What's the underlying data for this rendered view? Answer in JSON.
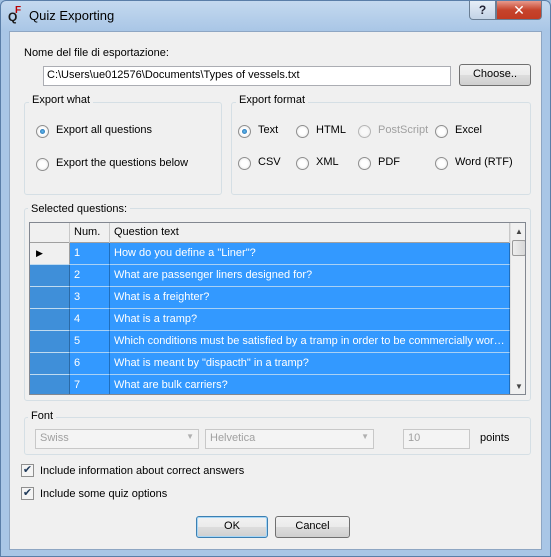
{
  "window": {
    "title": "Quiz Exporting",
    "help_label": "?",
    "close_label": "✕",
    "icon_letters": {
      "q": "Q",
      "f": "F"
    }
  },
  "file": {
    "label": "Nome del file di esportazione:",
    "path": "C:\\Users\\ue012576\\Documents\\Types of vessels.txt",
    "choose_label": "Choose.."
  },
  "export_what": {
    "title": "Export what",
    "options": [
      {
        "label": "Export all questions",
        "checked": true
      },
      {
        "label": "Export the questions below",
        "checked": false
      }
    ]
  },
  "export_format": {
    "title": "Export format",
    "options": [
      {
        "label": "Text",
        "checked": true,
        "enabled": true
      },
      {
        "label": "HTML",
        "checked": false,
        "enabled": true
      },
      {
        "label": "PostScript",
        "checked": false,
        "enabled": false
      },
      {
        "label": "Excel",
        "checked": false,
        "enabled": true
      },
      {
        "label": "CSV",
        "checked": false,
        "enabled": true
      },
      {
        "label": "XML",
        "checked": false,
        "enabled": true
      },
      {
        "label": "PDF",
        "checked": false,
        "enabled": true
      },
      {
        "label": "Word (RTF)",
        "checked": false,
        "enabled": true
      }
    ]
  },
  "questions": {
    "title": "Selected questions:",
    "columns": [
      "Num.",
      "Question text"
    ],
    "rows": [
      {
        "num": "1",
        "text": " How do you define a \"Liner\"?",
        "current": true
      },
      {
        "num": "2",
        "text": "What are passenger liners designed for?"
      },
      {
        "num": "3",
        "text": "What is a freighter?"
      },
      {
        "num": "4",
        "text": "What is a tramp?"
      },
      {
        "num": "5",
        "text": "Which conditions must be satisfied by a tramp in order to be commercially worthw..."
      },
      {
        "num": "6",
        "text": "What is meant by \"dispacth\" in a tramp?"
      },
      {
        "num": "7",
        "text": "What are bulk carriers?"
      }
    ],
    "current_marker": "▶"
  },
  "font": {
    "title": "Font",
    "family": "Swiss",
    "face": "Helvetica",
    "size": "10",
    "size_unit": "points"
  },
  "checkboxes": [
    {
      "label": "Include information about correct answers",
      "checked": true
    },
    {
      "label": "Include some quiz options",
      "checked": true
    }
  ],
  "buttons": {
    "ok": "OK",
    "cancel": "Cancel"
  }
}
